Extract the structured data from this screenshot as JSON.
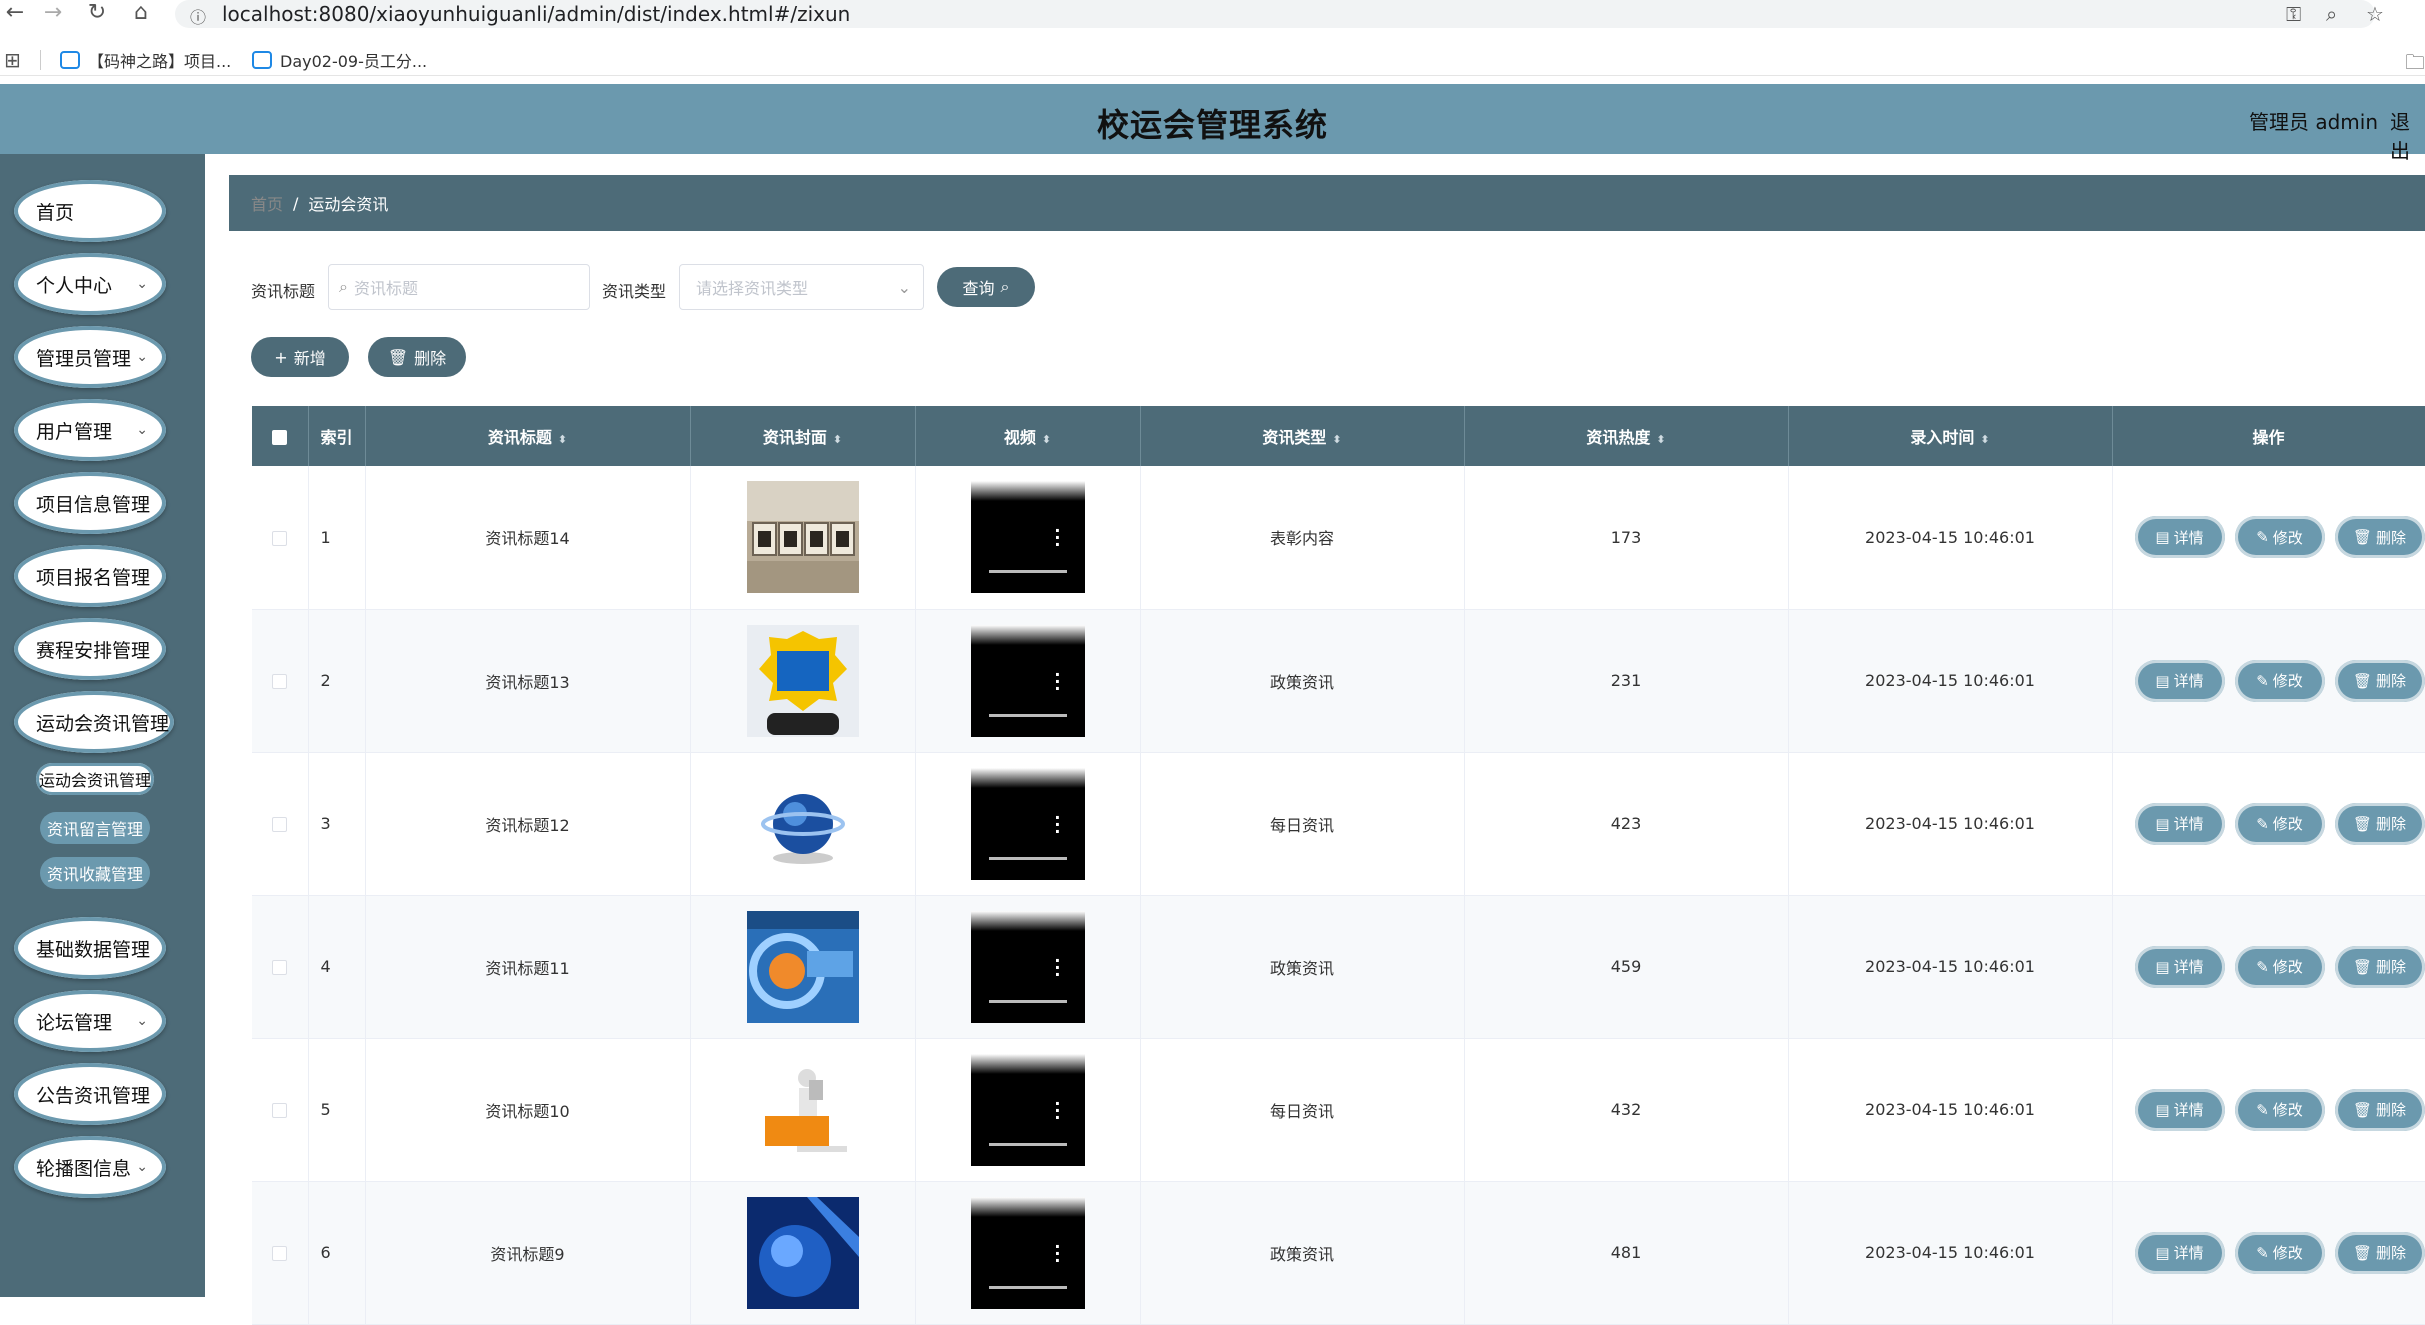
{
  "browser": {
    "url": "localhost:8080/xiaoyunhuiguanli/admin/dist/index.html#/zixun",
    "bookmarks": [
      "【码神之路】项目...",
      "Day02-09-员工分..."
    ]
  },
  "header": {
    "title": "校运会管理系统",
    "admin_label": "管理员 admin",
    "logout": "退出"
  },
  "sidebar": {
    "items": [
      {
        "label": "首页",
        "has_arrow": false
      },
      {
        "label": "个人中心",
        "has_arrow": true
      },
      {
        "label": "管理员管理",
        "has_arrow": true
      },
      {
        "label": "用户管理",
        "has_arrow": true
      },
      {
        "label": "项目信息管理",
        "has_arrow": false
      },
      {
        "label": "项目报名管理",
        "has_arrow": false
      },
      {
        "label": "赛程安排管理",
        "has_arrow": false
      },
      {
        "label": "运动会资讯管理",
        "has_arrow": false
      },
      {
        "label": "基础数据管理",
        "has_arrow": false
      },
      {
        "label": "论坛管理",
        "has_arrow": true
      },
      {
        "label": "公告资讯管理",
        "has_arrow": false
      },
      {
        "label": "轮播图信息",
        "has_arrow": true
      }
    ],
    "sub_items": [
      "运动会资讯管理",
      "资讯留言管理",
      "资讯收藏管理"
    ]
  },
  "breadcrumb": {
    "home": "首页",
    "separator": "/",
    "current": "运动会资讯"
  },
  "filters": {
    "title_label": "资讯标题",
    "title_placeholder": "资讯标题",
    "type_label": "资讯类型",
    "type_placeholder": "请选择资讯类型",
    "query_button": "查询"
  },
  "actions": {
    "add_button": "新增",
    "delete_button": "删除"
  },
  "table": {
    "columns": [
      "索引",
      "资讯标题",
      "资讯封面",
      "视频",
      "资讯类型",
      "资讯热度",
      "录入时间",
      "操作"
    ],
    "rows": [
      {
        "index": "1",
        "title": "资讯标题14",
        "type": "表彰内容",
        "heat": "173",
        "time": "2023-04-15 10:46:01",
        "cover": "news-blocks"
      },
      {
        "index": "2",
        "title": "资讯标题13",
        "type": "政策资讯",
        "heat": "231",
        "time": "2023-04-15 10:46:01",
        "cover": "hot-news-phone"
      },
      {
        "index": "3",
        "title": "资讯标题12",
        "type": "每日资讯",
        "heat": "423",
        "time": "2023-04-15 10:46:01",
        "cover": "news-globe"
      },
      {
        "index": "4",
        "title": "资讯标题11",
        "type": "政策资讯",
        "heat": "459",
        "time": "2023-04-15 10:46:01",
        "cover": "news-blue"
      },
      {
        "index": "5",
        "title": "资讯标题10",
        "type": "每日资讯",
        "heat": "432",
        "time": "2023-04-15 10:46:01",
        "cover": "news-figure"
      },
      {
        "index": "6",
        "title": "资讯标题9",
        "type": "政策资讯",
        "heat": "481",
        "time": "2023-04-15 10:46:01",
        "cover": "blue-globe"
      }
    ],
    "op_labels": {
      "detail": "详情",
      "edit": "修改",
      "delete": "删除"
    }
  },
  "colors": {
    "header": "#6b99ae",
    "sidebar": "#4d6b78",
    "accent": "#4d6b78"
  }
}
